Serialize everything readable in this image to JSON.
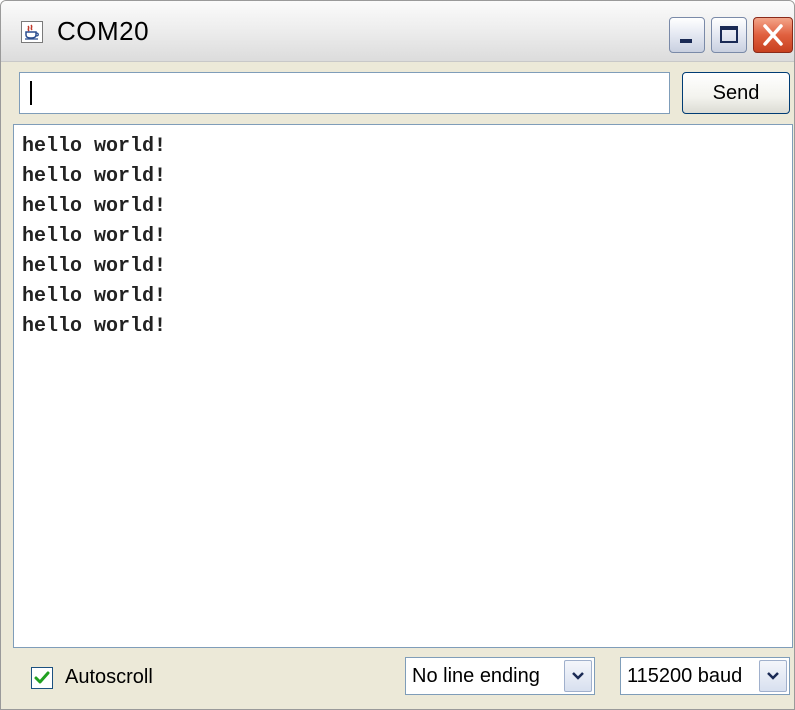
{
  "window": {
    "title": "COM20",
    "icons": {
      "app": "java-coffee-cup-icon",
      "minimize": "minimize-icon",
      "maximize": "maximize-icon",
      "close": "close-icon"
    },
    "colors": {
      "close_button": "#d9522f",
      "output_background": "#ffffff",
      "chrome_background": "#ece9d8"
    }
  },
  "send": {
    "input_value": "",
    "button_label": "Send"
  },
  "output": {
    "lines": [
      "hello world!",
      "hello world!",
      "hello world!",
      "hello world!",
      "hello world!",
      "hello world!",
      "hello world!"
    ]
  },
  "footer": {
    "autoscroll_label": "Autoscroll",
    "autoscroll_checked": true,
    "line_ending_value": "No line ending",
    "baud_value": "115200 baud"
  }
}
